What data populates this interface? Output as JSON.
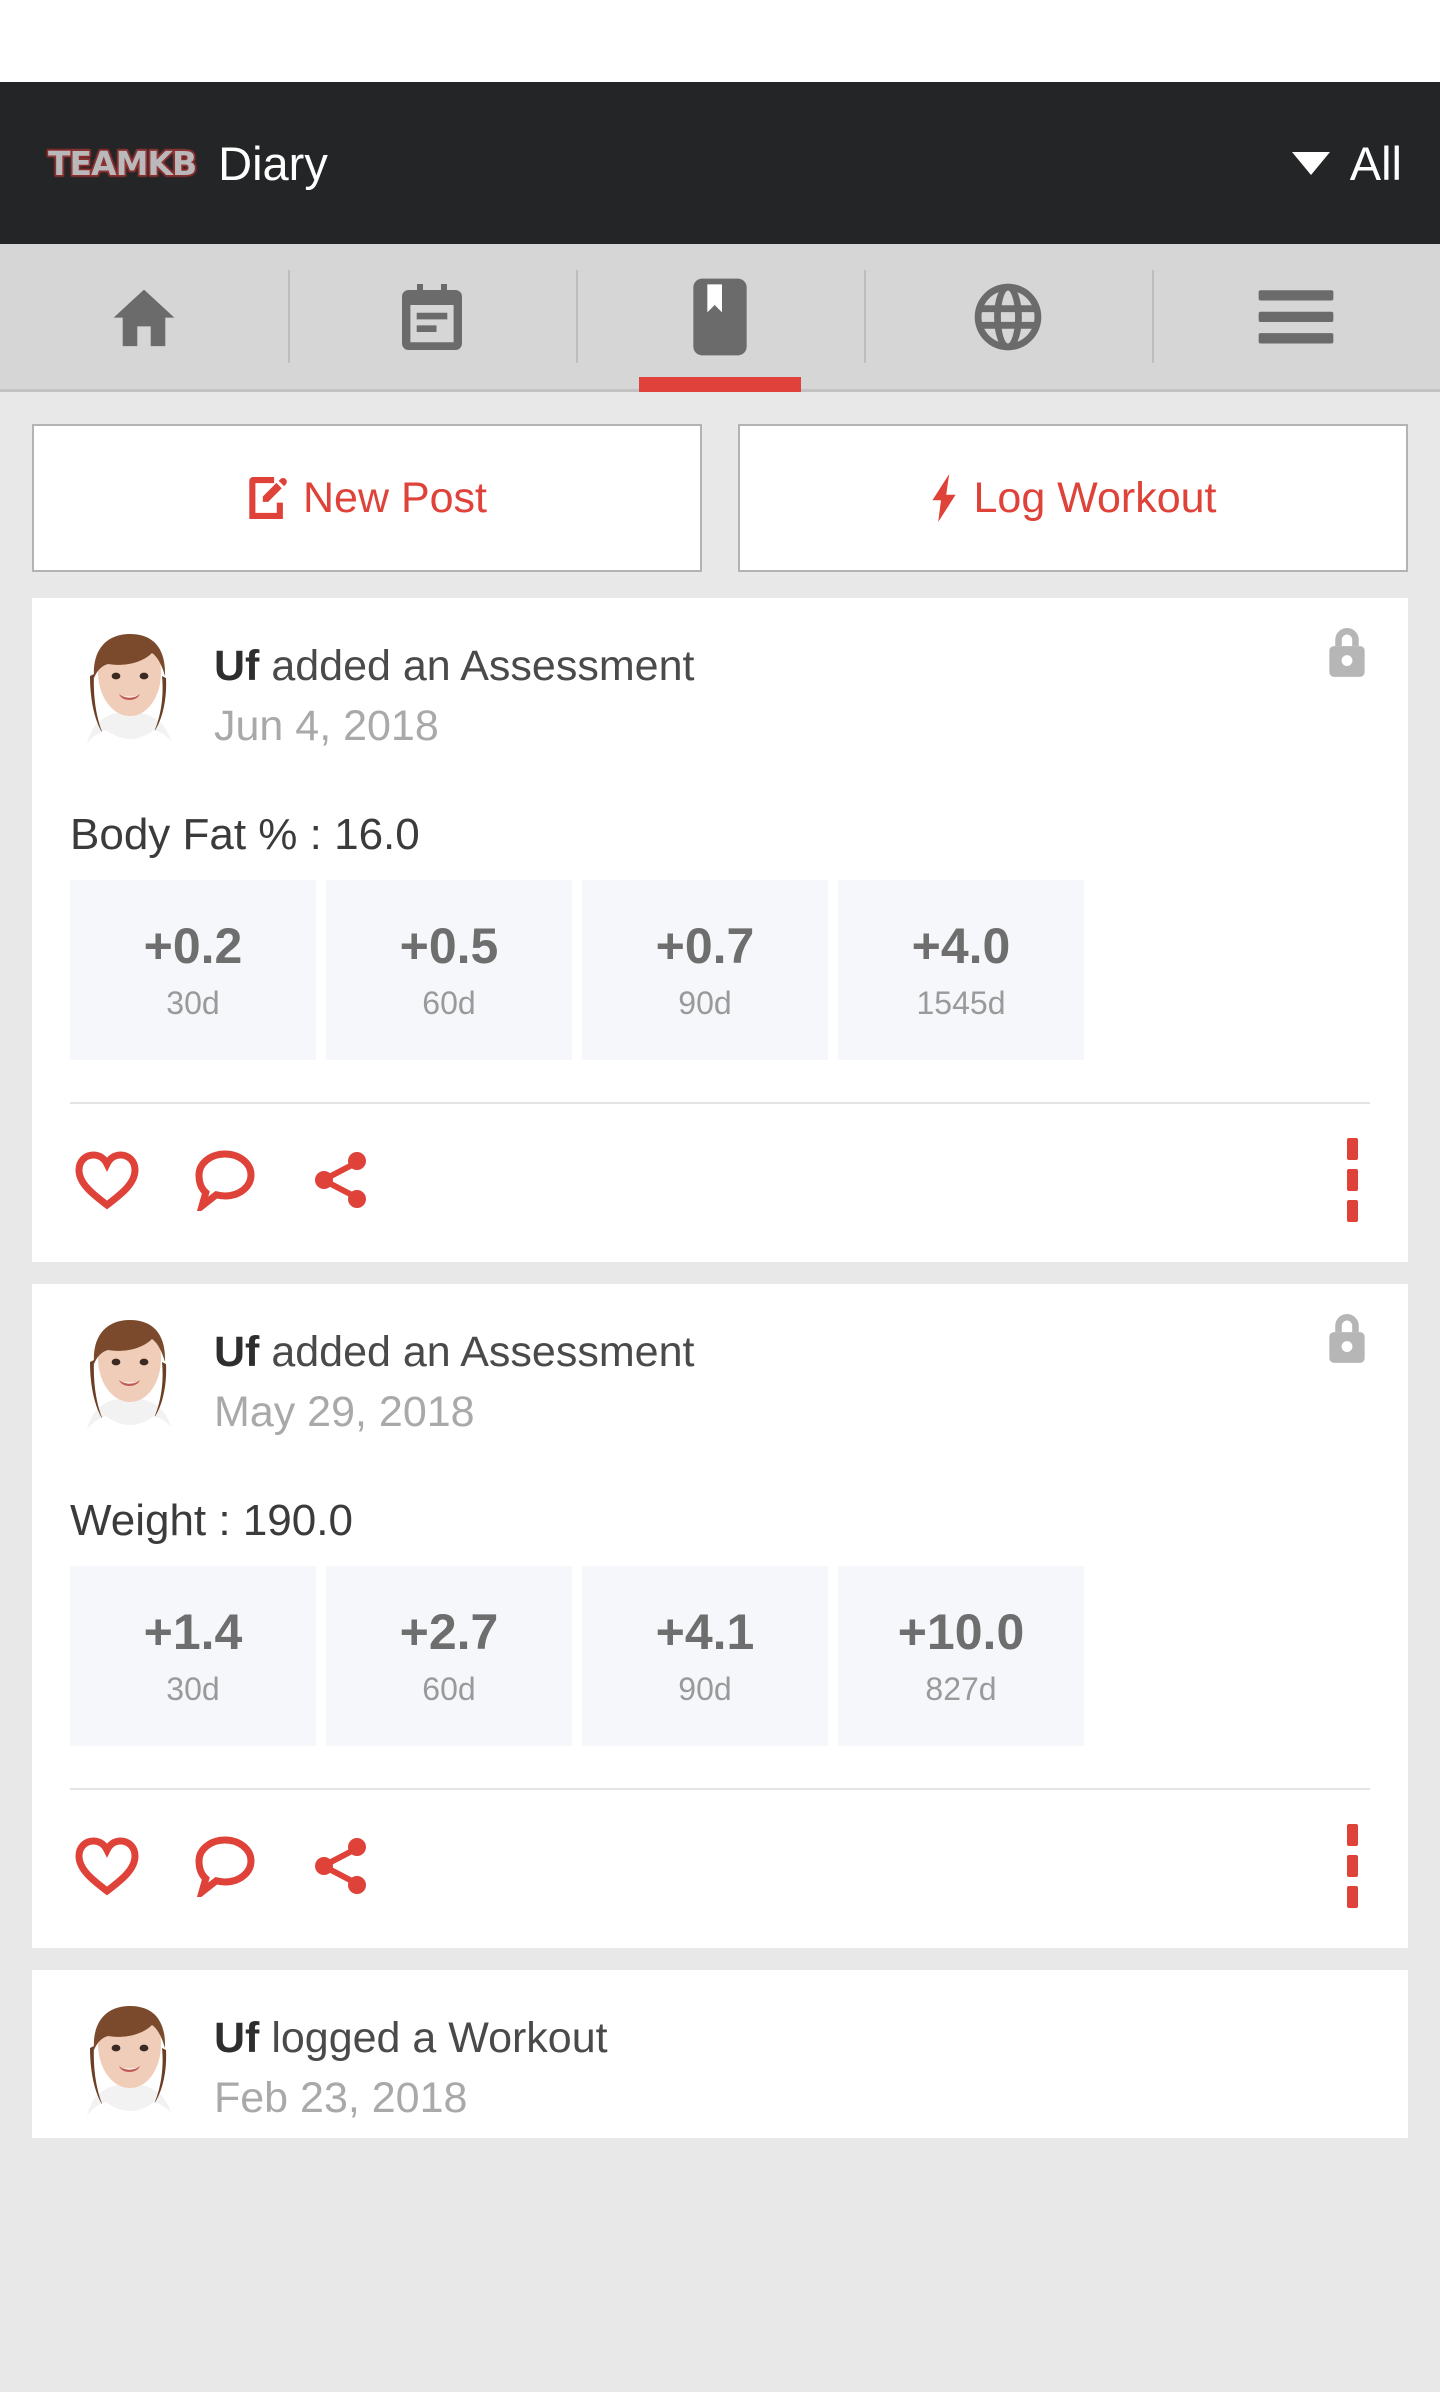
{
  "header": {
    "logo_text": "TEAMKB",
    "title": "Diary",
    "filter_label": "All",
    "caret_icon": "chevron-down-icon",
    "background": "#242526"
  },
  "tabs": [
    {
      "name": "home",
      "icon": "home-icon",
      "active": false
    },
    {
      "name": "calendar",
      "icon": "calendar-icon",
      "active": false
    },
    {
      "name": "diary",
      "icon": "book-icon",
      "active": true
    },
    {
      "name": "community",
      "icon": "globe-icon",
      "active": false
    },
    {
      "name": "menu",
      "icon": "hamburger-icon",
      "active": false
    }
  ],
  "accent_color": "#df4238",
  "actions": {
    "new_post_label": "New Post",
    "new_post_icon": "edit-icon",
    "log_workout_label": "Log Workout",
    "log_workout_icon": "bolt-icon"
  },
  "feed": [
    {
      "user": "Uf",
      "action": " added an Assessment",
      "date": "Jun 4, 2018",
      "privacy_icon": "lock-icon",
      "metric": "Body Fat % : 16.0",
      "stats": [
        {
          "value": "+0.2",
          "label": "30d"
        },
        {
          "value": "+0.5",
          "label": "60d"
        },
        {
          "value": "+0.7",
          "label": "90d"
        },
        {
          "value": "+4.0",
          "label": "1545d"
        }
      ],
      "like_icon": "heart-icon",
      "comment_icon": "comment-icon",
      "share_icon": "share-icon",
      "more_icon": "more-vertical-icon"
    },
    {
      "user": "Uf",
      "action": " added an Assessment",
      "date": "May 29, 2018",
      "privacy_icon": "lock-icon",
      "metric": "Weight : 190.0",
      "stats": [
        {
          "value": "+1.4",
          "label": "30d"
        },
        {
          "value": "+2.7",
          "label": "60d"
        },
        {
          "value": "+4.1",
          "label": "90d"
        },
        {
          "value": "+10.0",
          "label": "827d"
        }
      ],
      "like_icon": "heart-icon",
      "comment_icon": "comment-icon",
      "share_icon": "share-icon",
      "more_icon": "more-vertical-icon"
    },
    {
      "user": "Uf",
      "action": " logged a Workout",
      "date": "Feb 23, 2018"
    }
  ]
}
